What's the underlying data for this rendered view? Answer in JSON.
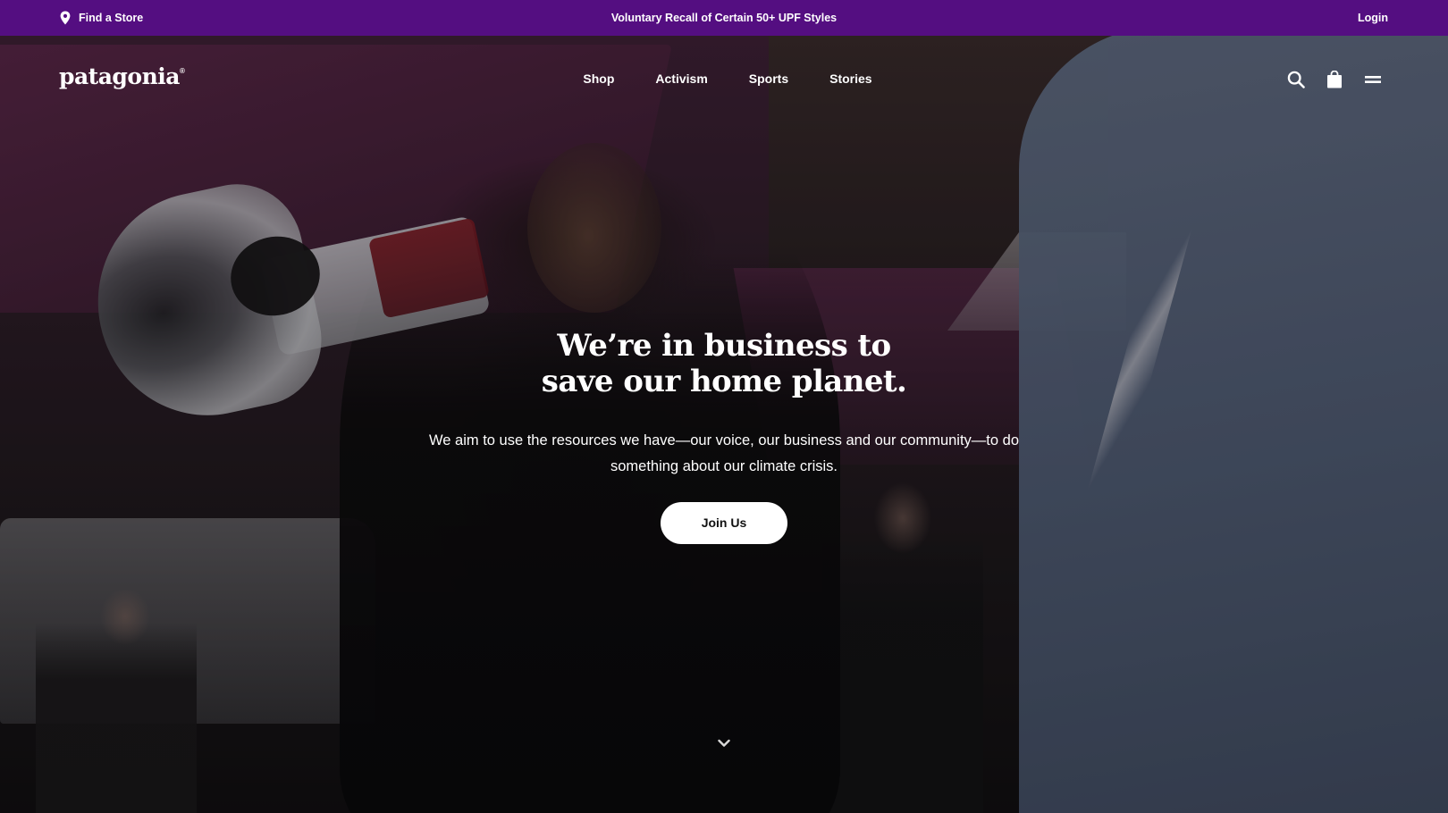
{
  "promo_bar": {
    "store_label": "Find a Store",
    "store_icon": "map-pin-icon",
    "message": "Voluntary Recall of Certain 50+ UPF Styles",
    "login_label": "Login",
    "background": "#540e81"
  },
  "header": {
    "logo_text": "patagonia",
    "logo_mark": "®",
    "nav": [
      {
        "label": "Shop"
      },
      {
        "label": "Activism"
      },
      {
        "label": "Sports"
      },
      {
        "label": "Stories"
      }
    ],
    "icons": [
      "search-icon",
      "shopping-bag-icon",
      "menu-icon"
    ]
  },
  "hero": {
    "title_line1": "We’re in business to",
    "title_line2": "save our home planet.",
    "subtitle": "We aim to use the resources we have—our voice, our business and our community—to do something about our climate crisis.",
    "cta_label": "Join Us",
    "scroll_icon": "chevron-down-icon"
  }
}
